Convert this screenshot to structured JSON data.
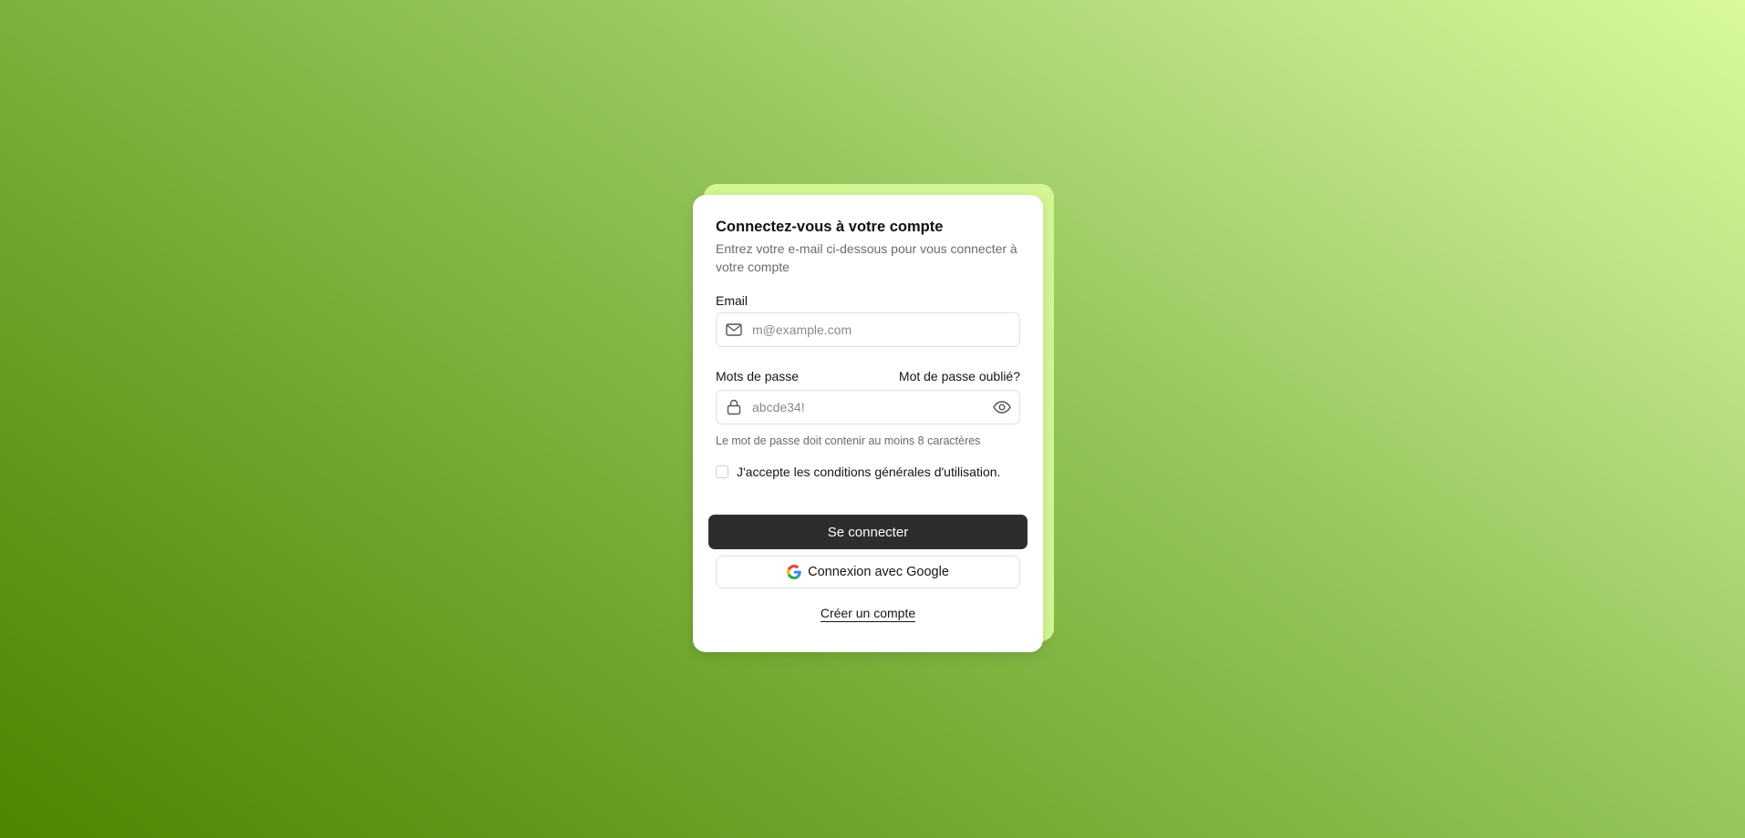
{
  "login": {
    "title": "Connectez-vous à votre compte",
    "subtitle": "Entrez votre e-mail ci-dessous pour vous connecter à votre compte",
    "email": {
      "label": "Email",
      "placeholder": "m@example.com",
      "value": "",
      "icon": "mail-icon"
    },
    "password": {
      "label": "Mots de passe",
      "forgot_link": "Mot de passe oublié?",
      "placeholder": "abcde34!",
      "value": "",
      "icon": "lock-icon",
      "toggle_icon": "eye-icon",
      "hint": "Le mot de passe doit contenir au moins 8 caractères"
    },
    "terms": {
      "label": "J'accepte les conditions générales d'utilisation.",
      "checked": false
    },
    "submit_label": "Se connecter",
    "google_label": "Connexion avec Google",
    "create_account_label": "Créer un compte"
  },
  "colors": {
    "primary_button": "#2d2d2d",
    "accent_back_card": "#d2f694",
    "background_start": "#4d8600",
    "background_end": "#d8fb98"
  }
}
